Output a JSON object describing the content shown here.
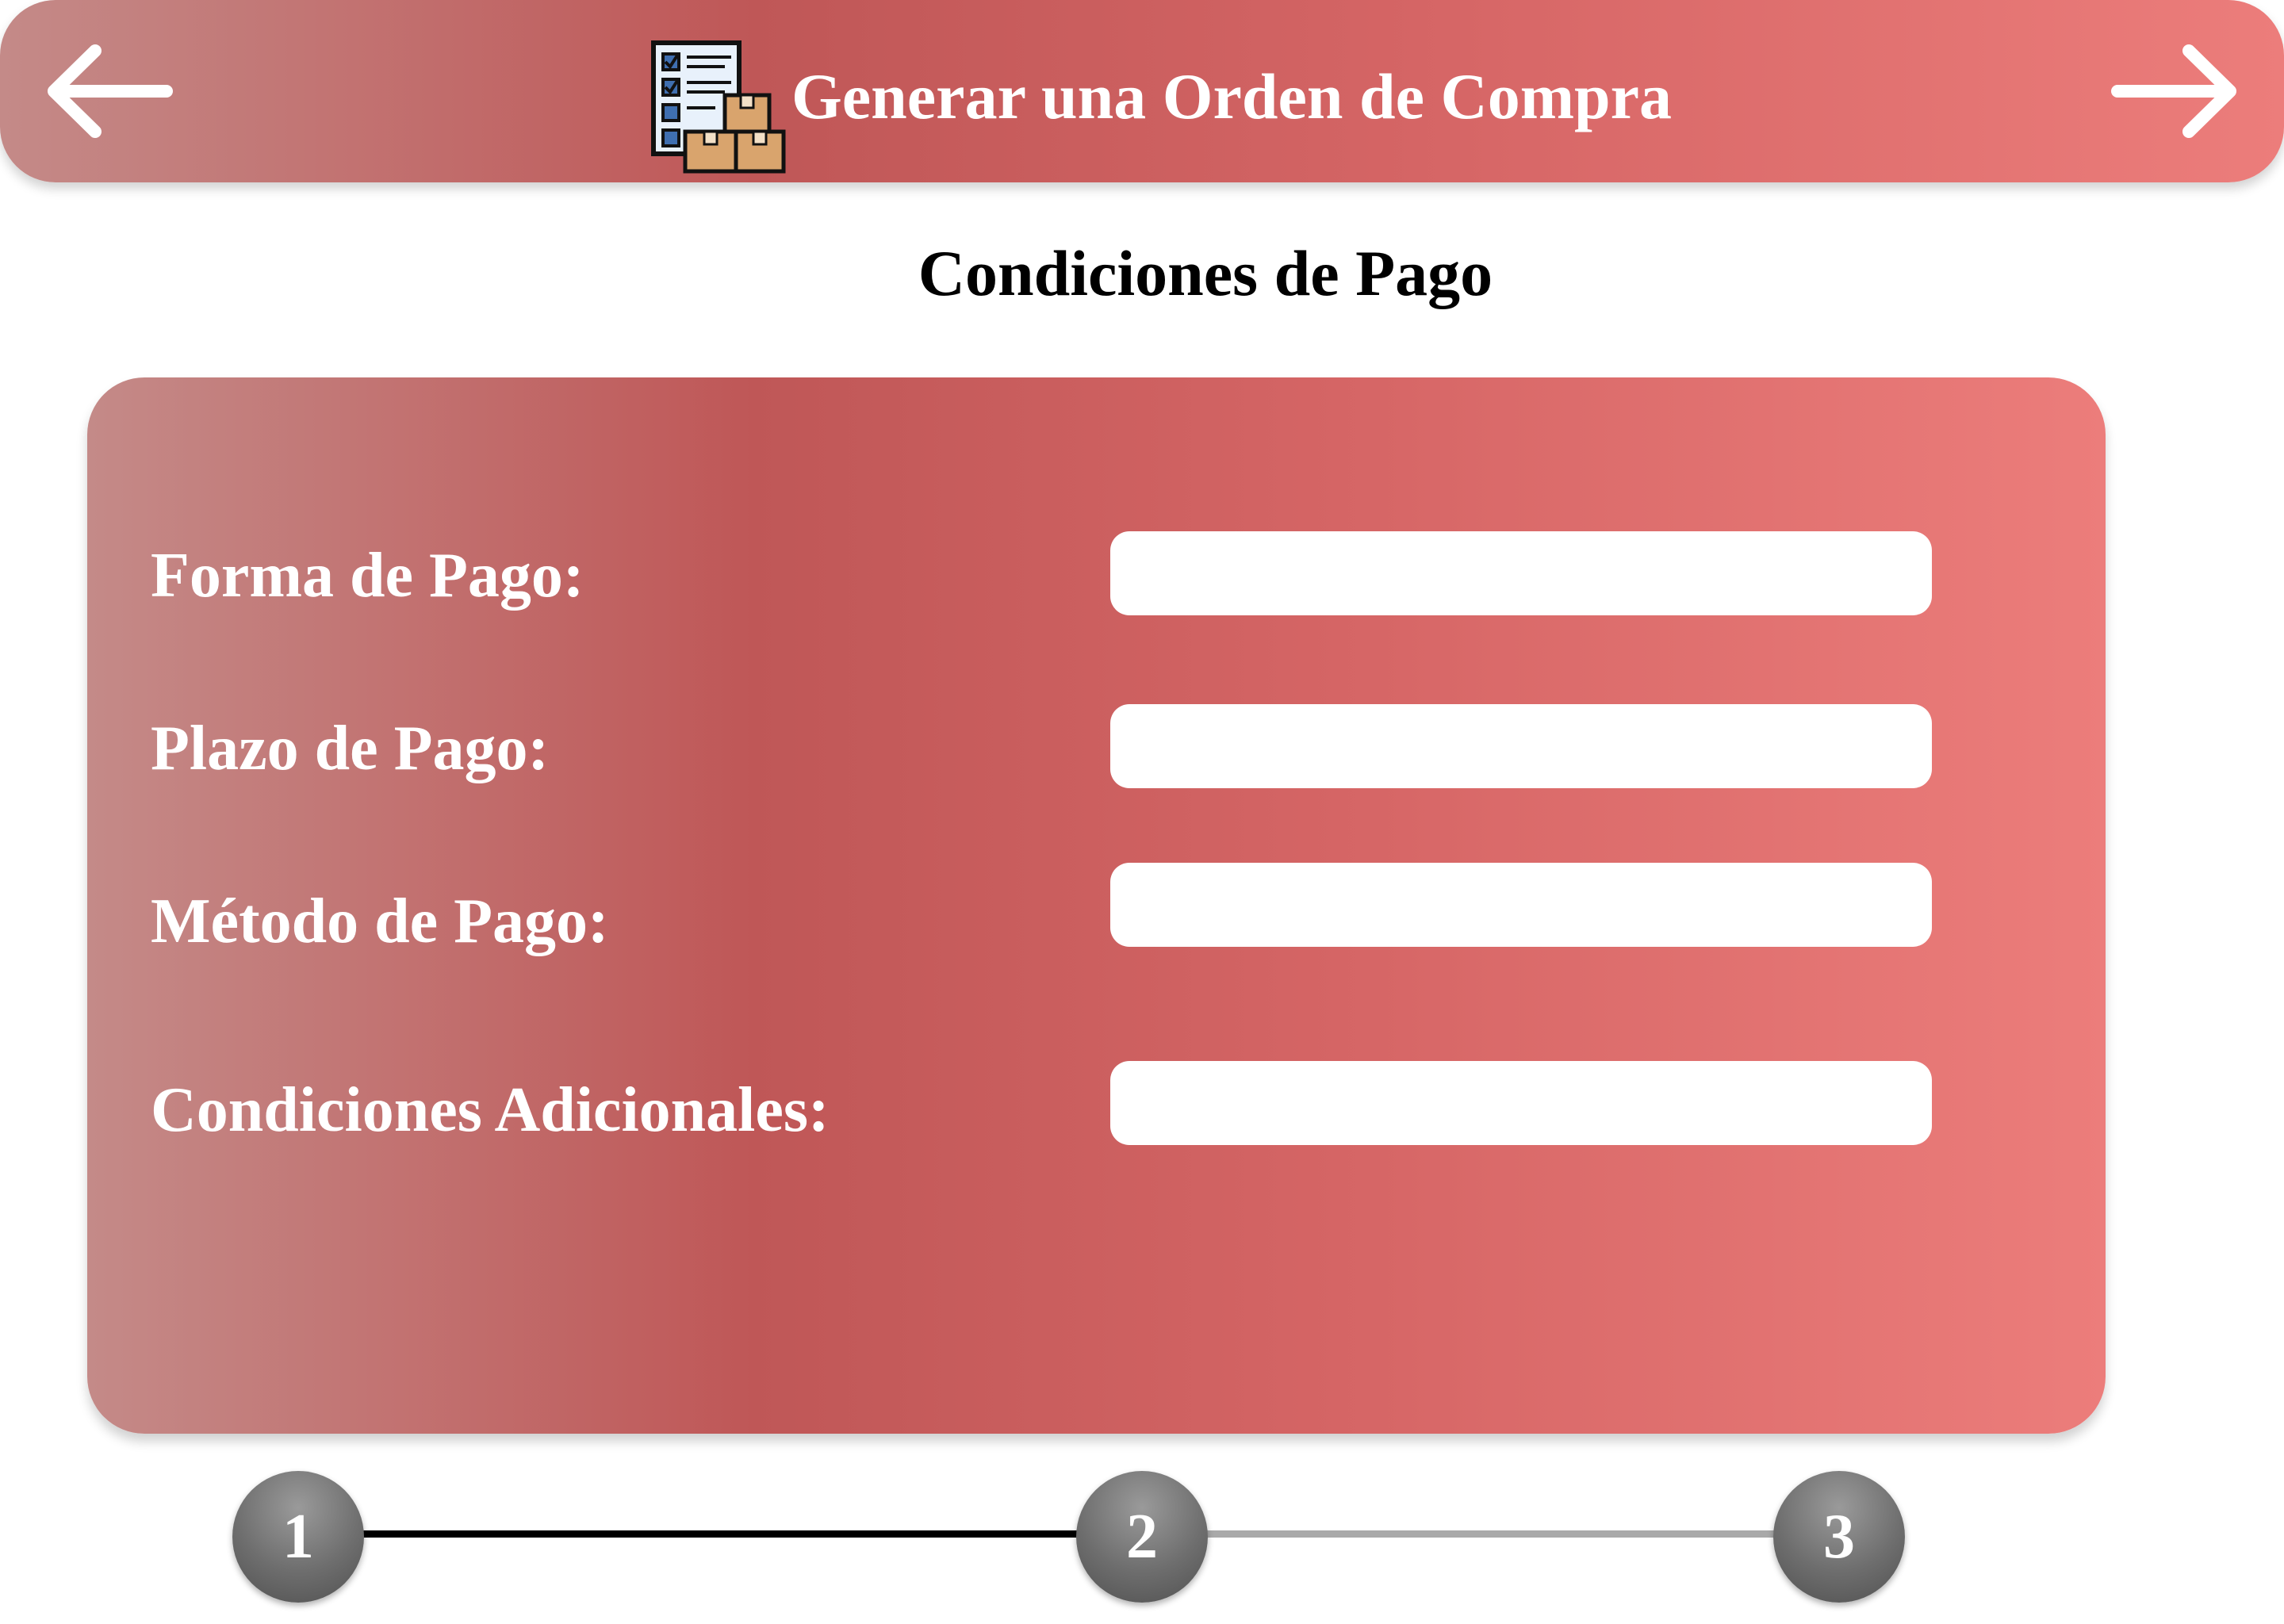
{
  "header": {
    "title": "Generar una Orden de Compra",
    "back_icon": "arrow-left-icon",
    "next_icon": "arrow-right-icon",
    "app_icon": "purchase-order-checklist-boxes-icon"
  },
  "section": {
    "title": "Condiciones de Pago"
  },
  "form": {
    "fields": [
      {
        "label": "Forma de Pago:",
        "value": ""
      },
      {
        "label": "Plazo de Pago:",
        "value": ""
      },
      {
        "label": "Método de Pago:",
        "value": ""
      },
      {
        "label": "Condiciones Adicionales:",
        "value": ""
      }
    ]
  },
  "stepper": {
    "steps": [
      "1",
      "2",
      "3"
    ],
    "current_step": 2
  },
  "colors": {
    "gradient": [
      "#c48a88",
      "#bf5757",
      "#d56565",
      "#ec7d7b"
    ],
    "step_circle": "#6e6e6e",
    "progress_done": "#000000",
    "progress_todo": "#a9a9a9"
  }
}
